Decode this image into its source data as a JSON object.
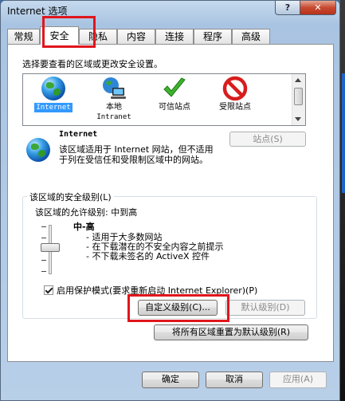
{
  "window": {
    "title": "Internet 选项",
    "help_label": "?",
    "close_label": "✕"
  },
  "tabs": [
    {
      "label": "常规"
    },
    {
      "label": "安全"
    },
    {
      "label": "隐私"
    },
    {
      "label": "内容"
    },
    {
      "label": "连接"
    },
    {
      "label": "程序"
    },
    {
      "label": "高级"
    }
  ],
  "active_tab": "安全",
  "zones": {
    "prompt": "选择要查看的区域或更改安全设置。",
    "items": [
      {
        "label": "Internet",
        "icon": "globe-icon"
      },
      {
        "label": "本地",
        "label2": "Intranet",
        "icon": "local-intranet-icon"
      },
      {
        "label": "可信站点",
        "icon": "checkmark-icon"
      },
      {
        "label": "受限站点",
        "icon": "no-entry-icon"
      }
    ]
  },
  "detail": {
    "title": "Internet",
    "description": "该区域适用于 Internet 网站，但不适用于列在受信任和受限制区域中的网站。",
    "sites_button": "站点(S)"
  },
  "security": {
    "group_label": "该区域的安全级别(L)",
    "allowed_levels": "该区域的允许级别: 中到高",
    "level_name": "中-高",
    "level_bullets": [
      "- 适用于大多数网站",
      "- 在下载潜在的不安全内容之前提示",
      "- 不下载未签名的 ActiveX 控件"
    ],
    "protected_mode": "启用保护模式(要求重新启动 Internet Explorer)(P)",
    "protected_mode_checked": true,
    "custom_button": "自定义级别(C)...",
    "default_button": "默认级别(D)",
    "reset_all_button": "将所有区域重置为默认级别(R)"
  },
  "footer": {
    "ok": "确定",
    "cancel": "取消",
    "apply": "应用(A)"
  },
  "colors": {
    "highlight": "#e0161c",
    "selection": "#3399ff"
  }
}
